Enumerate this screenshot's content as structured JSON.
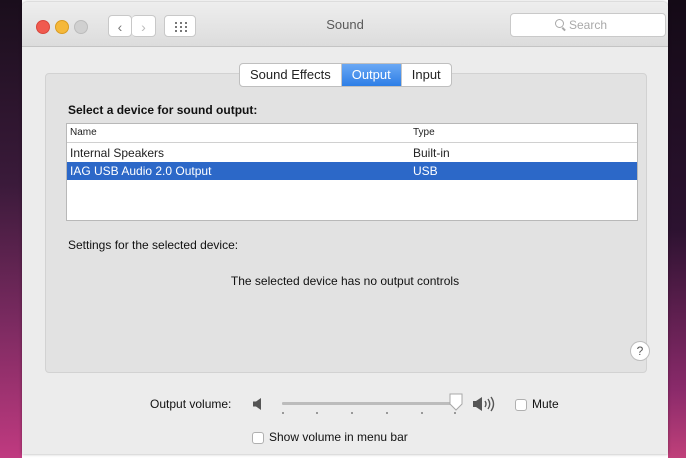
{
  "window": {
    "title": "Sound",
    "nav_back": "‹",
    "nav_forward": "›",
    "traffic_lights": {
      "close": "#f05a4f",
      "minimize": "#f5b83a",
      "zoom": "#d0d0d0"
    }
  },
  "search": {
    "placeholder": "Search"
  },
  "tabs": [
    {
      "label": "Sound Effects",
      "selected": false
    },
    {
      "label": "Output",
      "selected": true
    },
    {
      "label": "Input",
      "selected": false
    }
  ],
  "output": {
    "heading": "Select a device for sound output:",
    "columns": {
      "name": "Name",
      "type": "Type"
    },
    "devices": [
      {
        "name": "Internal Speakers",
        "type": "Built-in",
        "selected": false
      },
      {
        "name": "IAG USB Audio 2.0 Output",
        "type": "USB",
        "selected": true
      }
    ],
    "settings_label": "Settings for the selected device:",
    "no_controls_message": "The selected device has no output controls",
    "help_label": "?"
  },
  "volume": {
    "label": "Output volume:",
    "level": 1.0,
    "mute_label": "Mute",
    "mute_checked": false,
    "show_in_menu_bar_label": "Show volume in menu bar",
    "show_in_menu_bar_checked": false
  },
  "colors": {
    "accent": "#2d7ee6",
    "selection": "#2c68c8"
  }
}
